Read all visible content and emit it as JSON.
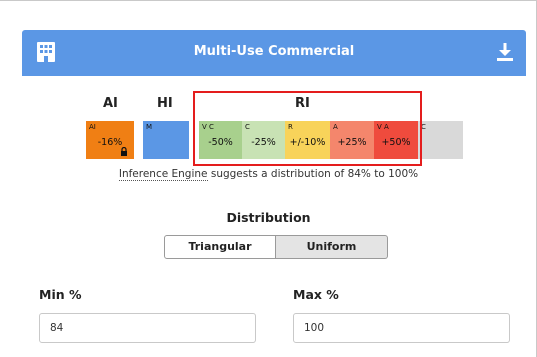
{
  "header": {
    "title": "Multi-Use Commercial",
    "left_icon": "building-icon",
    "right_icon": "download-icon",
    "color": "#5b97e5"
  },
  "groups": {
    "ai": "AI",
    "hi": "HI",
    "ri": "RI"
  },
  "rating_cells": [
    {
      "code": "AI",
      "value": "-16%",
      "color": "#f07f14",
      "locked": true
    },
    {
      "code": "M",
      "value": "",
      "color": "#5b97e5"
    },
    {
      "code": "V C",
      "value": "-50%",
      "color": "#a8d08d"
    },
    {
      "code": "C",
      "value": "-25%",
      "color": "#c8e2b4"
    },
    {
      "code": "R",
      "value": "+/-10%",
      "color": "#f8d35a"
    },
    {
      "code": "A",
      "value": "+25%",
      "color": "#f4866c"
    },
    {
      "code": "V A",
      "value": "+50%",
      "color": "#ef4b3d"
    },
    {
      "code": "C",
      "value": "",
      "color": "#d9d9d9"
    }
  ],
  "suggestion": {
    "prefix": "Inference Engine",
    "rest": " suggests a distribution of 84% to 100%"
  },
  "distribution": {
    "label": "Distribution",
    "options": [
      "Triangular",
      "Uniform"
    ],
    "selected": "Uniform"
  },
  "min": {
    "label": "Min %",
    "value": "84"
  },
  "max": {
    "label": "Max %",
    "value": "100"
  }
}
